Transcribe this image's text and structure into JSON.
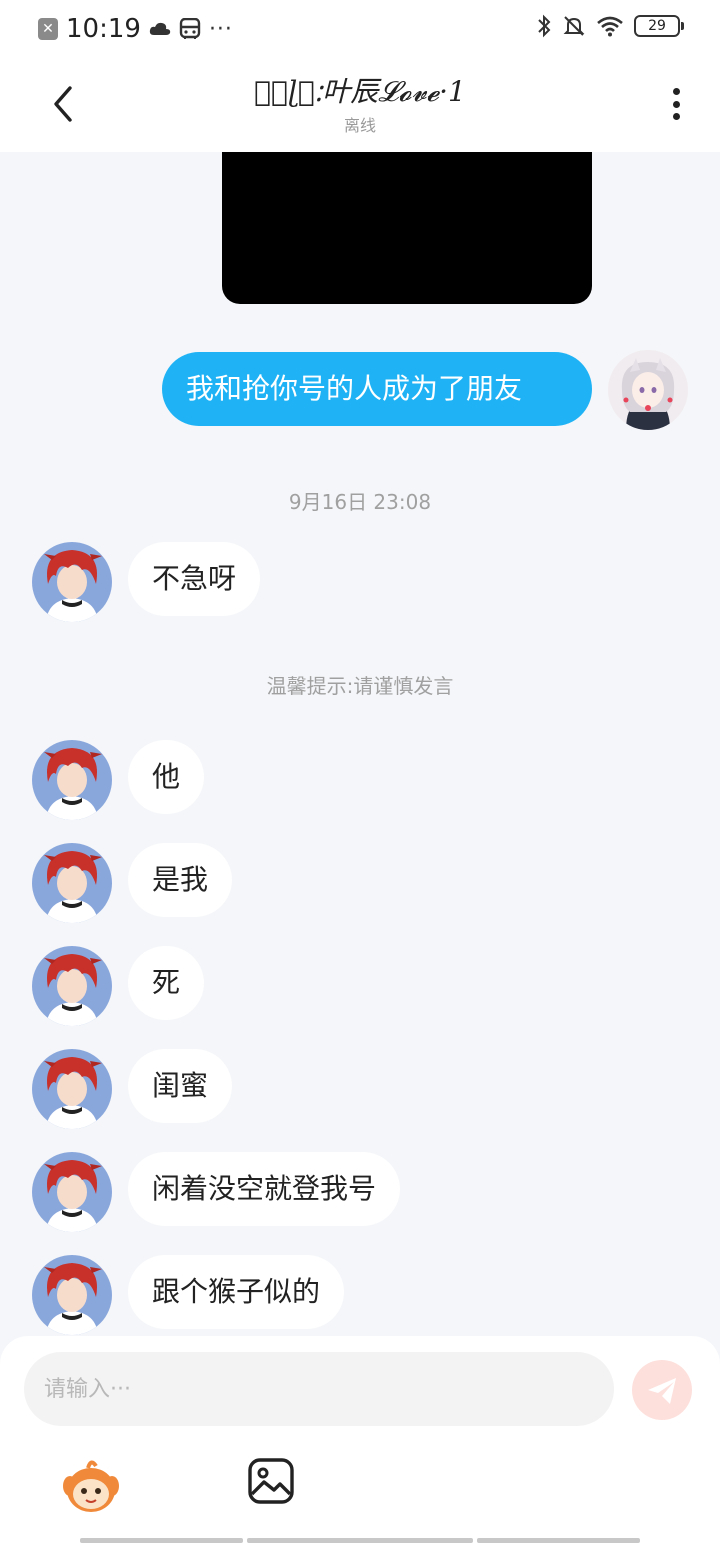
{
  "status_bar": {
    "time": "10:19",
    "dots": "···",
    "battery": "29"
  },
  "header": {
    "title": "ᑕ⃝ɭ⃝ᱺ叶辰𝓛𝓸𝓿𝓮·1",
    "status": "离线"
  },
  "messages": {
    "outgoing_1": "我和抢你号的人成为了朋友",
    "timestamp": "9月16日 23:08",
    "incoming_1": "不急呀",
    "tip": "温馨提示:请谨慎发言",
    "incoming_2": "他",
    "incoming_3": "是我",
    "incoming_4": "死",
    "incoming_5": "闺蜜",
    "incoming_6": "闲着没空就登我号",
    "incoming_7": "跟个猴子似的"
  },
  "composer": {
    "placeholder": "请输入···"
  },
  "colors": {
    "outgoing_bubble": "#1fb3f5",
    "background": "#f4f6f9",
    "send_button": "#fde0dc"
  },
  "icons": {
    "back": "back-arrow-icon",
    "more": "more-vertical-icon",
    "send": "paper-plane-icon",
    "emoji": "emoji-mascot-icon",
    "image": "image-icon"
  }
}
